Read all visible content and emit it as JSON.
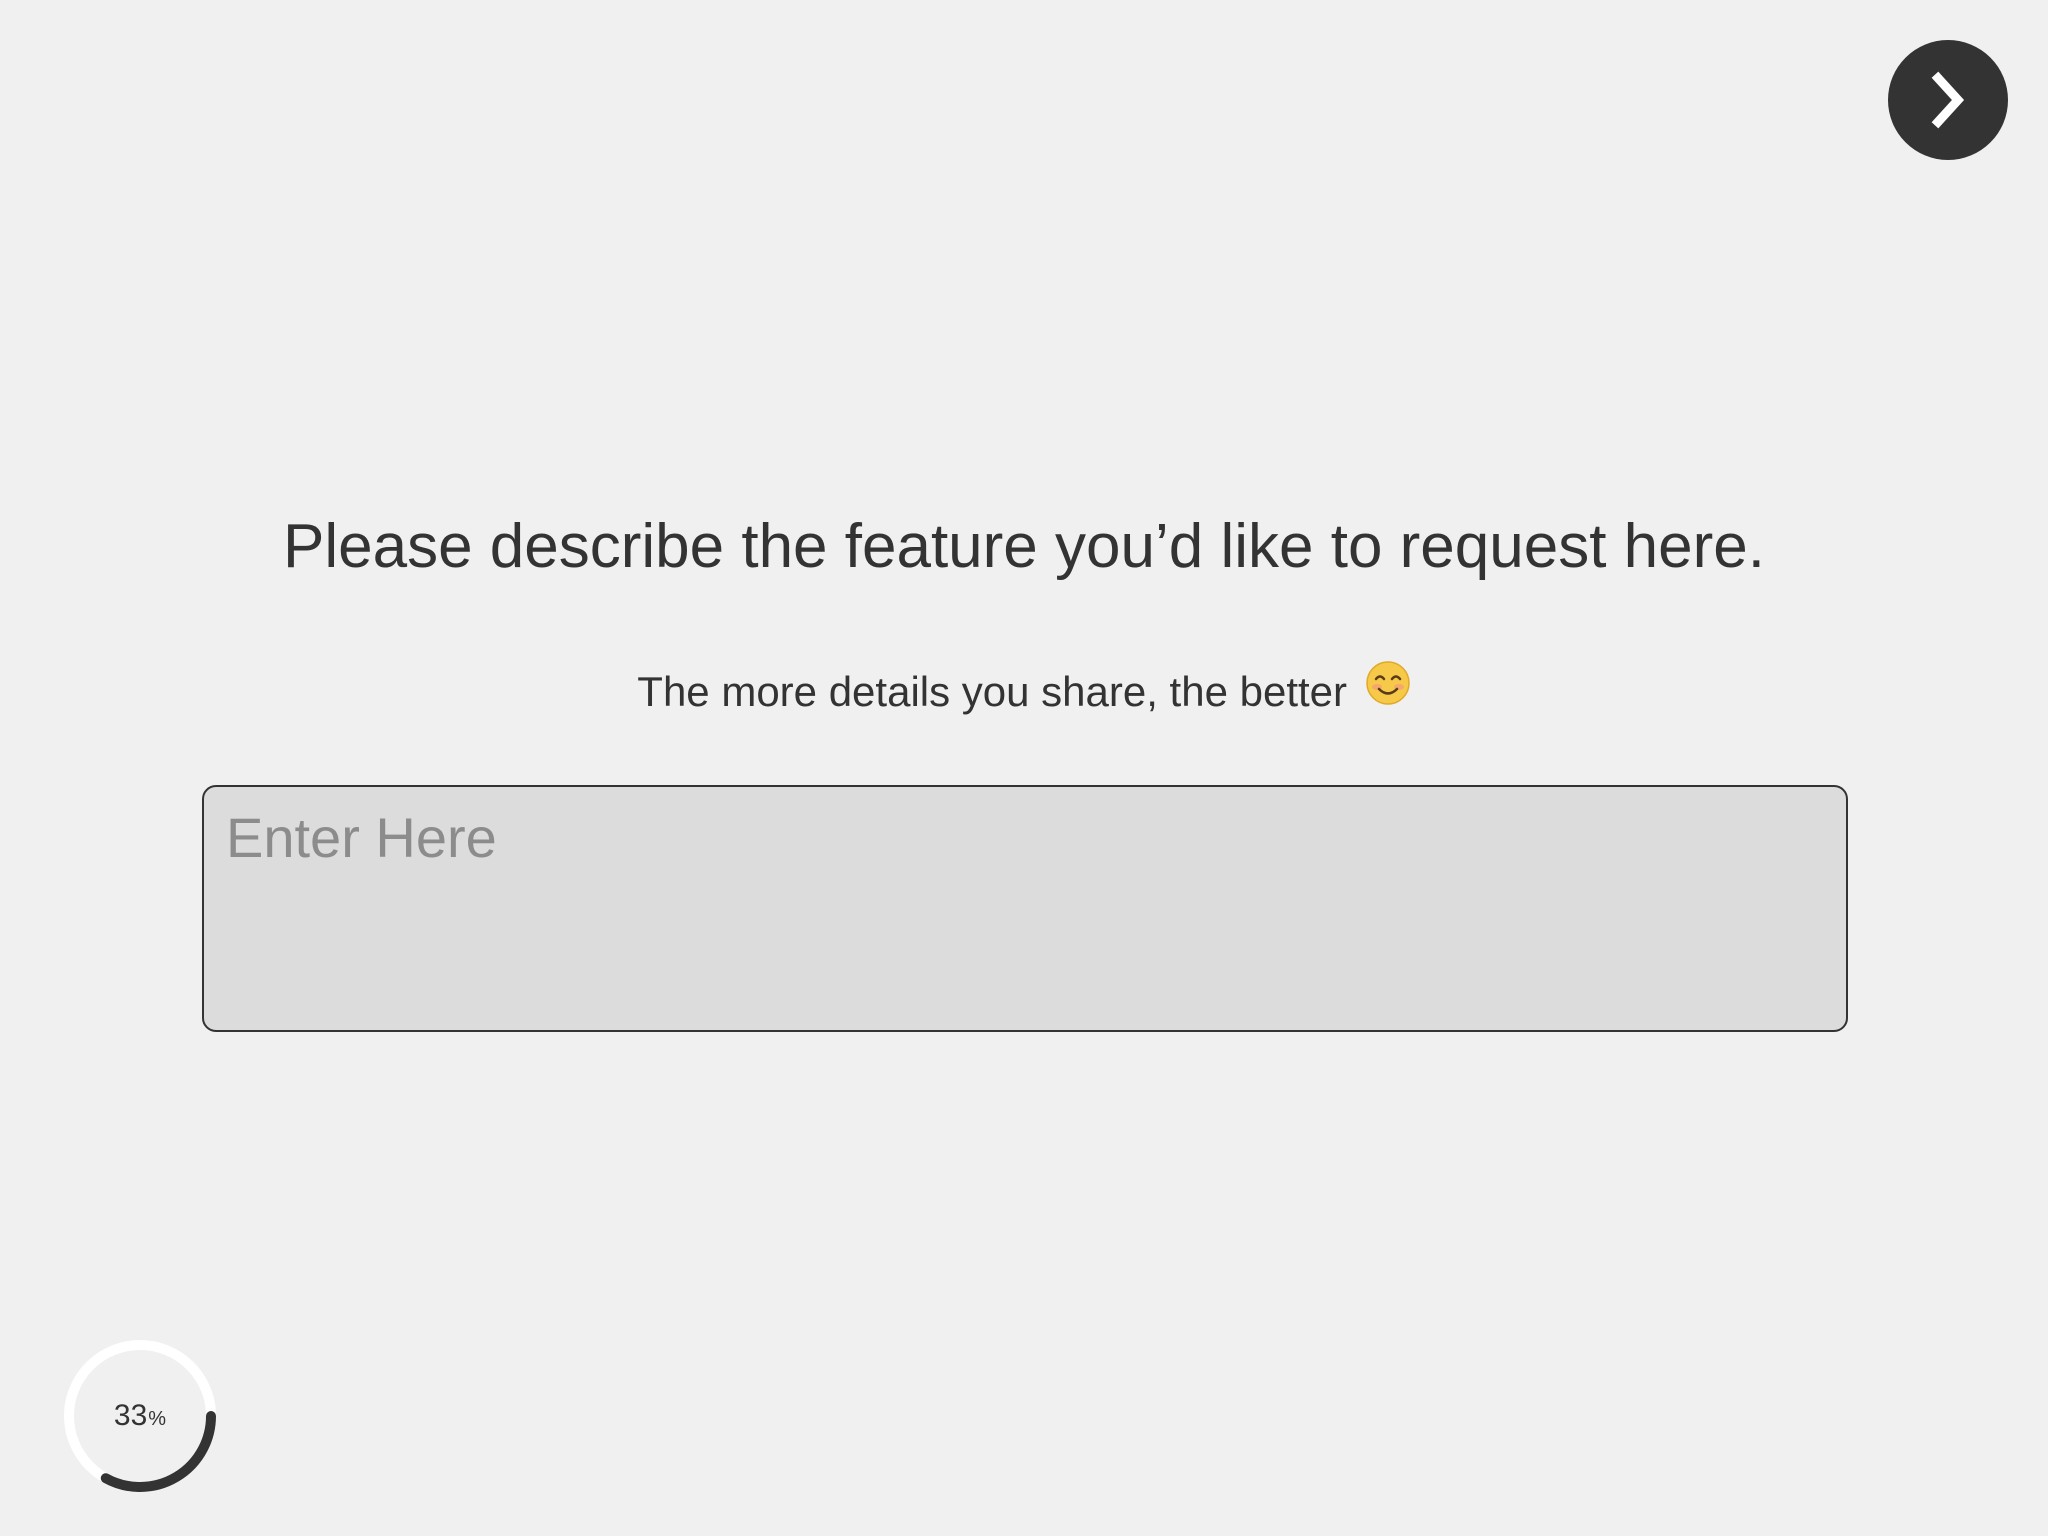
{
  "navigation": {
    "next_icon": "chevron-right-icon"
  },
  "question": {
    "title": "Please describe the feature you’d like to request here.",
    "subtitle": "The more details you share, the better",
    "subtitle_icon": "smiling-face-emoji-icon"
  },
  "answer": {
    "placeholder": "Enter Here",
    "value": ""
  },
  "progress": {
    "value": "33",
    "unit": "%",
    "fraction": 0.33
  },
  "colors": {
    "background": "#f0f0f0",
    "text": "#333333",
    "input_background": "#dcdcdc",
    "placeholder": "#8c8c8c",
    "emoji": "#f5c542"
  }
}
